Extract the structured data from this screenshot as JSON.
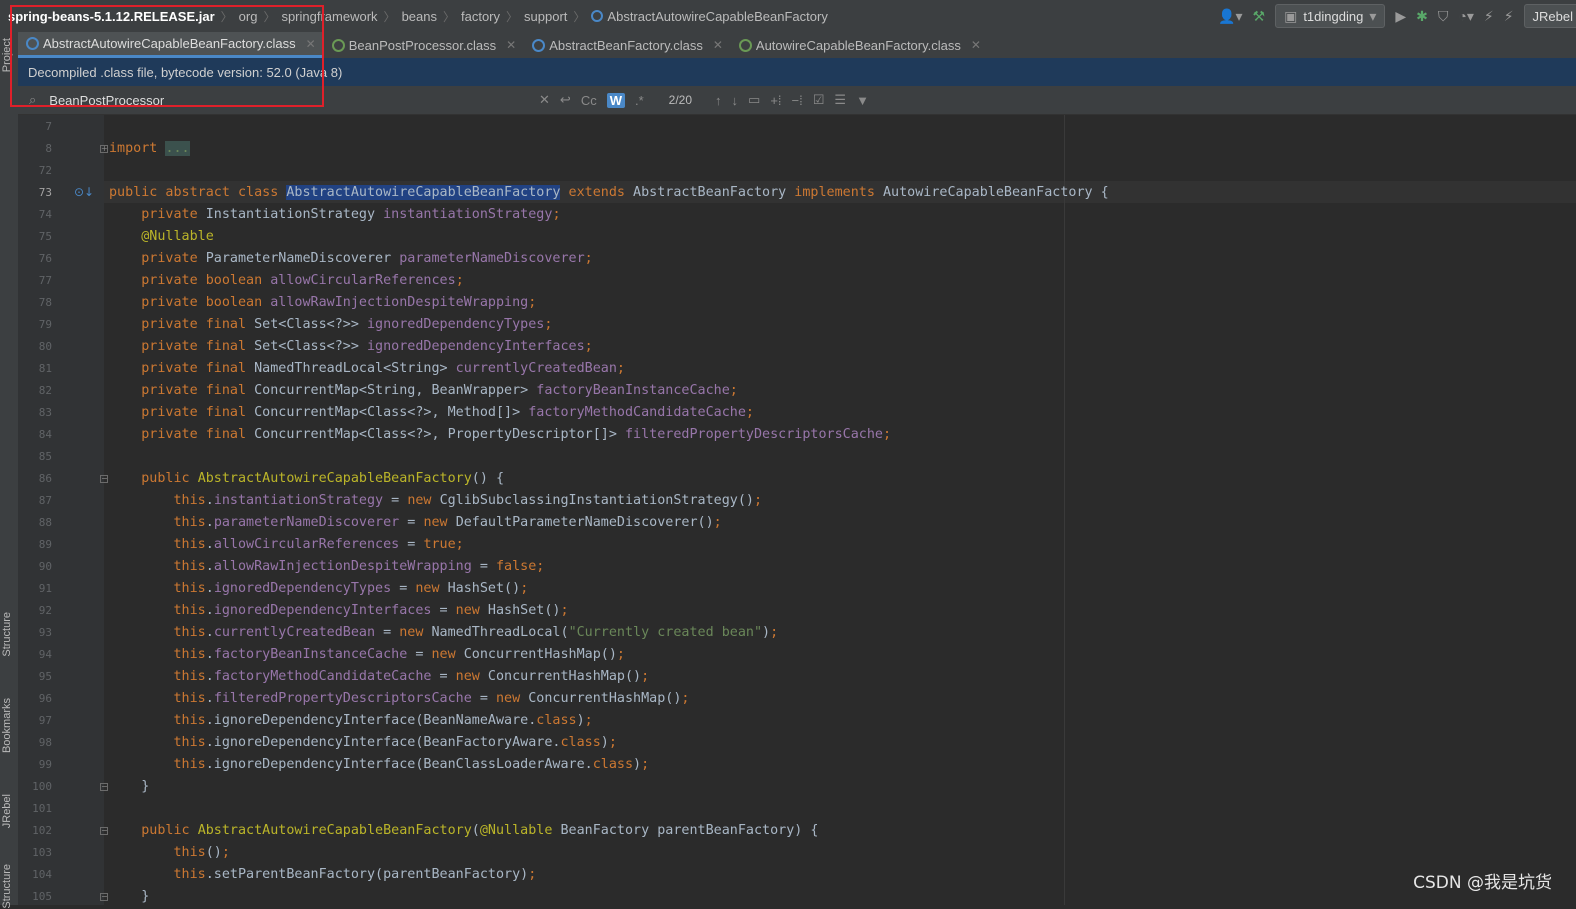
{
  "breadcrumb": [
    "spring-beans-5.1.12.RELEASE.jar",
    "org",
    "springframework",
    "beans",
    "factory",
    "support",
    "AbstractAutowireCapableBeanFactory"
  ],
  "toolbar": {
    "run_config": "t1dingding",
    "jrebel": "JRebel"
  },
  "tabs": [
    {
      "label": "AbstractAutowireCapableBeanFactory.class",
      "icon": "class-icon"
    },
    {
      "label": "BeanPostProcessor.class",
      "icon": "interface-icon"
    },
    {
      "label": "AbstractBeanFactory.class",
      "icon": "class-icon"
    },
    {
      "label": "AutowireCapableBeanFactory.class",
      "icon": "interface-icon"
    }
  ],
  "banner": "Decompiled .class file, bytecode version: 52.0 (Java 8)",
  "find": {
    "query": "BeanPostProcessor",
    "match_count": "2/20",
    "cc": "Cc",
    "w": "W"
  },
  "side_tabs": {
    "project": "Project",
    "structure": "Structure",
    "bookmarks": "Bookmarks",
    "jrebel": "JRebel",
    "structure2": "Structure"
  },
  "line_numbers": [
    "7",
    "8",
    "72",
    "73",
    "74",
    "75",
    "76",
    "77",
    "78",
    "79",
    "80",
    "81",
    "82",
    "83",
    "84",
    "85",
    "86",
    "87",
    "88",
    "89",
    "90",
    "91",
    "92",
    "93",
    "94",
    "95",
    "96",
    "97",
    "98",
    "99",
    "100",
    "101",
    "102",
    "103",
    "104",
    "105"
  ],
  "code": [
    [],
    [
      [
        "kw",
        "import "
      ],
      [
        "foldtxt",
        "..."
      ]
    ],
    [],
    [
      [
        "kw",
        "public abstract class "
      ],
      [
        "hl",
        "AbstractAutowireCapableBeanFactory"
      ],
      [
        "kw",
        " extends "
      ],
      [
        "",
        "AbstractBeanFactory"
      ],
      [
        "kw",
        " implements "
      ],
      [
        "",
        "AutowireCapableBeanFactory {"
      ]
    ],
    [
      [
        "",
        "    "
      ],
      [
        "kw",
        "private "
      ],
      [
        "",
        "InstantiationStrategy "
      ],
      [
        "fld",
        "instantiationStrategy"
      ],
      [
        "kw",
        ";"
      ]
    ],
    [
      [
        "",
        "    "
      ],
      [
        "ann",
        "@Nullable"
      ]
    ],
    [
      [
        "",
        "    "
      ],
      [
        "kw",
        "private "
      ],
      [
        "",
        "ParameterNameDiscoverer "
      ],
      [
        "fld",
        "parameterNameDiscoverer"
      ],
      [
        "kw",
        ";"
      ]
    ],
    [
      [
        "",
        "    "
      ],
      [
        "kw",
        "private boolean "
      ],
      [
        "fld",
        "allowCircularReferences"
      ],
      [
        "kw",
        ";"
      ]
    ],
    [
      [
        "",
        "    "
      ],
      [
        "kw",
        "private boolean "
      ],
      [
        "fld",
        "allowRawInjectionDespiteWrapping"
      ],
      [
        "kw",
        ";"
      ]
    ],
    [
      [
        "",
        "    "
      ],
      [
        "kw",
        "private final "
      ],
      [
        "",
        "Set<Class<?>> "
      ],
      [
        "fld",
        "ignoredDependencyTypes"
      ],
      [
        "kw",
        ";"
      ]
    ],
    [
      [
        "",
        "    "
      ],
      [
        "kw",
        "private final "
      ],
      [
        "",
        "Set<Class<?>> "
      ],
      [
        "fld",
        "ignoredDependencyInterfaces"
      ],
      [
        "kw",
        ";"
      ]
    ],
    [
      [
        "",
        "    "
      ],
      [
        "kw",
        "private final "
      ],
      [
        "",
        "NamedThreadLocal<String> "
      ],
      [
        "fld",
        "currentlyCreatedBean"
      ],
      [
        "kw",
        ";"
      ]
    ],
    [
      [
        "",
        "    "
      ],
      [
        "kw",
        "private final "
      ],
      [
        "",
        "ConcurrentMap<String, BeanWrapper> "
      ],
      [
        "fld",
        "factoryBeanInstanceCache"
      ],
      [
        "kw",
        ";"
      ]
    ],
    [
      [
        "",
        "    "
      ],
      [
        "kw",
        "private final "
      ],
      [
        "",
        "ConcurrentMap<Class<?>, Method[]> "
      ],
      [
        "fld",
        "factoryMethodCandidateCache"
      ],
      [
        "kw",
        ";"
      ]
    ],
    [
      [
        "",
        "    "
      ],
      [
        "kw",
        "private final "
      ],
      [
        "",
        "ConcurrentMap<Class<?>, PropertyDescriptor[]> "
      ],
      [
        "fld",
        "filteredPropertyDescriptorsCache"
      ],
      [
        "kw",
        ";"
      ]
    ],
    [],
    [
      [
        "",
        "    "
      ],
      [
        "kw",
        "public "
      ],
      [
        "ann",
        "AbstractAutowireCapableBeanFactory"
      ],
      [
        "",
        "() {"
      ]
    ],
    [
      [
        "",
        "        "
      ],
      [
        "kw",
        "this"
      ],
      [
        "",
        "."
      ],
      [
        "fld",
        "instantiationStrategy"
      ],
      [
        "",
        " = "
      ],
      [
        "kw",
        "new "
      ],
      [
        "",
        "CglibSubclassingInstantiationStrategy()"
      ],
      [
        "kw",
        ";"
      ]
    ],
    [
      [
        "",
        "        "
      ],
      [
        "kw",
        "this"
      ],
      [
        "",
        "."
      ],
      [
        "fld",
        "parameterNameDiscoverer"
      ],
      [
        "",
        " = "
      ],
      [
        "kw",
        "new "
      ],
      [
        "",
        "DefaultParameterNameDiscoverer()"
      ],
      [
        "kw",
        ";"
      ]
    ],
    [
      [
        "",
        "        "
      ],
      [
        "kw",
        "this"
      ],
      [
        "",
        "."
      ],
      [
        "fld",
        "allowCircularReferences"
      ],
      [
        "",
        " = "
      ],
      [
        "kw",
        "true;"
      ]
    ],
    [
      [
        "",
        "        "
      ],
      [
        "kw",
        "this"
      ],
      [
        "",
        "."
      ],
      [
        "fld",
        "allowRawInjectionDespiteWrapping"
      ],
      [
        "",
        " = "
      ],
      [
        "kw",
        "false;"
      ]
    ],
    [
      [
        "",
        "        "
      ],
      [
        "kw",
        "this"
      ],
      [
        "",
        "."
      ],
      [
        "fld",
        "ignoredDependencyTypes"
      ],
      [
        "",
        " = "
      ],
      [
        "kw",
        "new "
      ],
      [
        "",
        "HashSet()"
      ],
      [
        "kw",
        ";"
      ]
    ],
    [
      [
        "",
        "        "
      ],
      [
        "kw",
        "this"
      ],
      [
        "",
        "."
      ],
      [
        "fld",
        "ignoredDependencyInterfaces"
      ],
      [
        "",
        " = "
      ],
      [
        "kw",
        "new "
      ],
      [
        "",
        "HashSet()"
      ],
      [
        "kw",
        ";"
      ]
    ],
    [
      [
        "",
        "        "
      ],
      [
        "kw",
        "this"
      ],
      [
        "",
        "."
      ],
      [
        "fld",
        "currentlyCreatedBean"
      ],
      [
        "",
        " = "
      ],
      [
        "kw",
        "new "
      ],
      [
        "",
        "NamedThreadLocal("
      ],
      [
        "str",
        "\"Currently created bean\""
      ],
      [
        "",
        ")"
      ],
      [
        "kw",
        ";"
      ]
    ],
    [
      [
        "",
        "        "
      ],
      [
        "kw",
        "this"
      ],
      [
        "",
        "."
      ],
      [
        "fld",
        "factoryBeanInstanceCache"
      ],
      [
        "",
        " = "
      ],
      [
        "kw",
        "new "
      ],
      [
        "",
        "ConcurrentHashMap()"
      ],
      [
        "kw",
        ";"
      ]
    ],
    [
      [
        "",
        "        "
      ],
      [
        "kw",
        "this"
      ],
      [
        "",
        "."
      ],
      [
        "fld",
        "factoryMethodCandidateCache"
      ],
      [
        "",
        " = "
      ],
      [
        "kw",
        "new "
      ],
      [
        "",
        "ConcurrentHashMap()"
      ],
      [
        "kw",
        ";"
      ]
    ],
    [
      [
        "",
        "        "
      ],
      [
        "kw",
        "this"
      ],
      [
        "",
        "."
      ],
      [
        "fld",
        "filteredPropertyDescriptorsCache"
      ],
      [
        "",
        " = "
      ],
      [
        "kw",
        "new "
      ],
      [
        "",
        "ConcurrentHashMap()"
      ],
      [
        "kw",
        ";"
      ]
    ],
    [
      [
        "",
        "        "
      ],
      [
        "kw",
        "this"
      ],
      [
        "",
        ".ignoreDependencyInterface(BeanNameAware."
      ],
      [
        "kw",
        "class"
      ],
      [
        "",
        ")"
      ],
      [
        "kw",
        ";"
      ]
    ],
    [
      [
        "",
        "        "
      ],
      [
        "kw",
        "this"
      ],
      [
        "",
        ".ignoreDependencyInterface(BeanFactoryAware."
      ],
      [
        "kw",
        "class"
      ],
      [
        "",
        ")"
      ],
      [
        "kw",
        ";"
      ]
    ],
    [
      [
        "",
        "        "
      ],
      [
        "kw",
        "this"
      ],
      [
        "",
        ".ignoreDependencyInterface(BeanClassLoaderAware."
      ],
      [
        "kw",
        "class"
      ],
      [
        "",
        ")"
      ],
      [
        "kw",
        ";"
      ]
    ],
    [
      [
        "",
        "    }"
      ]
    ],
    [],
    [
      [
        "",
        "    "
      ],
      [
        "kw",
        "public "
      ],
      [
        "ann",
        "AbstractAutowireCapableBeanFactory"
      ],
      [
        "",
        "("
      ],
      [
        "ann",
        "@Nullable "
      ],
      [
        "",
        "BeanFactory parentBeanFactory) {"
      ]
    ],
    [
      [
        "",
        "        "
      ],
      [
        "kw",
        "this"
      ],
      [
        "",
        "()"
      ],
      [
        "kw",
        ";"
      ]
    ],
    [
      [
        "",
        "        "
      ],
      [
        "kw",
        "this"
      ],
      [
        "",
        ".setParentBeanFactory(parentBeanFactory)"
      ],
      [
        "kw",
        ";"
      ]
    ],
    [
      [
        "",
        "    }"
      ]
    ]
  ],
  "watermark": "CSDN @我是坑货"
}
